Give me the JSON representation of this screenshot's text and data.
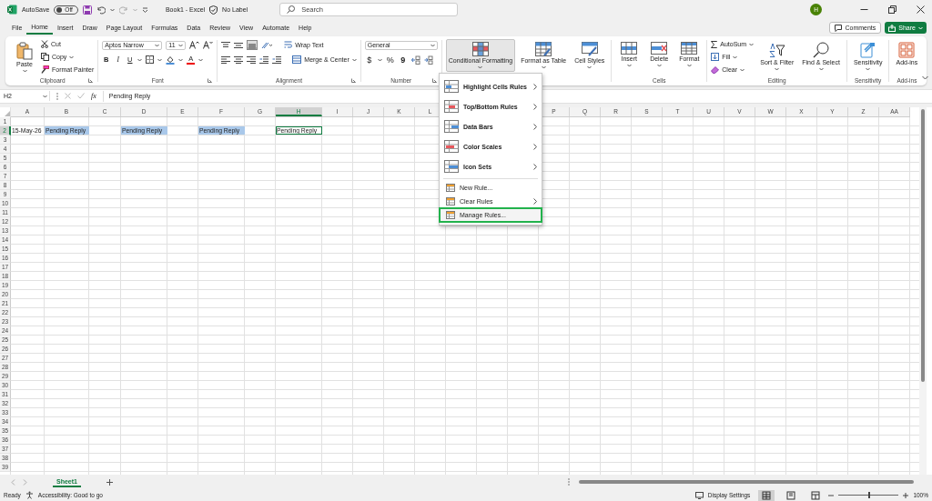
{
  "title_bar": {
    "autosave_label": "AutoSave",
    "autosave_state": "Off",
    "autosave_on": false,
    "title": "Book1  -  Excel",
    "sensitivity": "No Label",
    "search_placeholder": "Search",
    "avatar": "H"
  },
  "tabs": [
    {
      "label": "File",
      "selected": false
    },
    {
      "label": "Home",
      "selected": true
    },
    {
      "label": "Insert",
      "selected": false
    },
    {
      "label": "Draw",
      "selected": false
    },
    {
      "label": "Page Layout",
      "selected": false
    },
    {
      "label": "Formulas",
      "selected": false
    },
    {
      "label": "Data",
      "selected": false
    },
    {
      "label": "Review",
      "selected": false
    },
    {
      "label": "View",
      "selected": false
    },
    {
      "label": "Automate",
      "selected": false
    },
    {
      "label": "Help",
      "selected": false
    }
  ],
  "comments": "Comments",
  "share": "Share",
  "ribbon": {
    "clipboard": {
      "label": "Clipboard",
      "paste": "Paste",
      "cut": "Cut",
      "copy": "Copy",
      "format_painter": "Format Painter"
    },
    "font": {
      "label": "Font",
      "name": "Aptos Narrow",
      "size": "11",
      "bold": "B",
      "italic": "I",
      "underline": "U",
      "font_color_label": "A"
    },
    "alignment": {
      "label": "Alignment",
      "wrap": "Wrap Text",
      "merge": "Merge & Center"
    },
    "number": {
      "label": "Number",
      "format": "General",
      "currency": "$",
      "percent": "%",
      "comma": "9"
    },
    "styles": {
      "conditional": "Conditional Formatting",
      "conditional_pressed": true,
      "table": "Format as Table",
      "cell_styles": "Cell Styles"
    },
    "cells": {
      "label": "Cells",
      "insert": "Insert",
      "delete": "Delete",
      "format": "Format"
    },
    "editing": {
      "label": "Editing",
      "autosum": "AutoSum",
      "fill": "Fill",
      "clear": "Clear",
      "sort": "Sort & Filter",
      "find": "Find & Select"
    },
    "sensitivity": {
      "label": "Sensitivity",
      "button": "Sensitivity"
    },
    "addins": {
      "label": "Add-ins",
      "button": "Add-ins"
    }
  },
  "formula_bar": {
    "name_box": "H2",
    "fx": "fx",
    "content": "Pending Reply"
  },
  "grid": {
    "columns_left": [
      {
        "label": "A",
        "selected": false
      },
      {
        "label": "B",
        "selected": false
      },
      {
        "label": "C",
        "selected": false
      },
      {
        "label": "D",
        "selected": false
      },
      {
        "label": "E",
        "selected": false
      },
      {
        "label": "F",
        "selected": false
      },
      {
        "label": "G",
        "selected": false
      },
      {
        "label": "H",
        "selected": true
      },
      {
        "label": "I",
        "selected": false
      },
      {
        "label": "J",
        "selected": false
      },
      {
        "label": "K",
        "selected": false
      },
      {
        "label": "L",
        "selected": false
      }
    ],
    "columns_right": [
      {
        "label": "P",
        "selected": false
      },
      {
        "label": "Q",
        "selected": false
      },
      {
        "label": "R",
        "selected": false
      },
      {
        "label": "S",
        "selected": false
      },
      {
        "label": "T",
        "selected": false
      },
      {
        "label": "U",
        "selected": false
      },
      {
        "label": "V",
        "selected": false
      },
      {
        "label": "W",
        "selected": false
      },
      {
        "label": "X",
        "selected": false
      },
      {
        "label": "Y",
        "selected": false
      },
      {
        "label": "Z",
        "selected": false
      },
      {
        "label": "AA",
        "selected": false
      }
    ],
    "rows": [
      {
        "label": "1",
        "selected": false
      },
      {
        "label": "2",
        "selected": true,
        "cells": [
          {
            "text": "15-May-26",
            "highlighted": false,
            "selected": false
          },
          {
            "text": "Pending Reply",
            "highlighted": true,
            "selected": false
          },
          {},
          {
            "text": "Pending Reply",
            "highlighted": true,
            "selected": false
          },
          {},
          {
            "text": "Pending Reply",
            "highlighted": true,
            "selected": false
          },
          {},
          {
            "text": "Pending Reply",
            "highlighted": false,
            "selected": true
          }
        ]
      },
      {
        "label": "3",
        "selected": false
      },
      {
        "label": "4",
        "selected": false
      },
      {
        "label": "5",
        "selected": false
      },
      {
        "label": "6",
        "selected": false
      },
      {
        "label": "7",
        "selected": false
      },
      {
        "label": "8",
        "selected": false
      },
      {
        "label": "9",
        "selected": false
      },
      {
        "label": "10",
        "selected": false
      },
      {
        "label": "11",
        "selected": false
      },
      {
        "label": "12",
        "selected": false
      },
      {
        "label": "13",
        "selected": false
      },
      {
        "label": "14",
        "selected": false
      },
      {
        "label": "15",
        "selected": false
      },
      {
        "label": "16",
        "selected": false
      },
      {
        "label": "17",
        "selected": false
      },
      {
        "label": "18",
        "selected": false
      },
      {
        "label": "19",
        "selected": false
      },
      {
        "label": "20",
        "selected": false
      },
      {
        "label": "21",
        "selected": false
      },
      {
        "label": "22",
        "selected": false
      },
      {
        "label": "23",
        "selected": false
      },
      {
        "label": "24",
        "selected": false
      },
      {
        "label": "25",
        "selected": false
      },
      {
        "label": "26",
        "selected": false
      },
      {
        "label": "27",
        "selected": false
      },
      {
        "label": "28",
        "selected": false
      },
      {
        "label": "29",
        "selected": false
      },
      {
        "label": "30",
        "selected": false
      },
      {
        "label": "31",
        "selected": false
      },
      {
        "label": "32",
        "selected": false
      },
      {
        "label": "33",
        "selected": false
      },
      {
        "label": "34",
        "selected": false
      },
      {
        "label": "35",
        "selected": false
      },
      {
        "label": "36",
        "selected": false
      },
      {
        "label": "37",
        "selected": false
      },
      {
        "label": "38",
        "selected": false
      },
      {
        "label": "39",
        "selected": false
      }
    ]
  },
  "menu": [
    {
      "label": "Highlight Cells Rules",
      "kind": "large",
      "submenu": true,
      "highlighted": false
    },
    {
      "label": "Top/Bottom Rules",
      "kind": "large",
      "submenu": true,
      "highlighted": false
    },
    {
      "label": "Data Bars",
      "kind": "large",
      "submenu": true,
      "highlighted": false
    },
    {
      "label": "Color Scales",
      "kind": "large",
      "submenu": true,
      "highlighted": false
    },
    {
      "label": "Icon Sets",
      "kind": "large",
      "submenu": true,
      "highlighted": false
    },
    {
      "label": "New Rule...",
      "kind": "small",
      "submenu": false,
      "highlighted": false
    },
    {
      "label": "Clear Rules",
      "kind": "small",
      "submenu": true,
      "highlighted": false
    },
    {
      "label": "Manage Rules...",
      "kind": "small",
      "submenu": false,
      "highlighted": true
    }
  ],
  "sheets": [
    {
      "label": "Sheet1",
      "selected": true
    }
  ],
  "status_bar": {
    "ready": "Ready",
    "accessibility": "Accessibility: Good to go",
    "display_settings": "Display Settings",
    "zoom": "100%",
    "zoom_slider": {
      "level": 0.5
    }
  }
}
